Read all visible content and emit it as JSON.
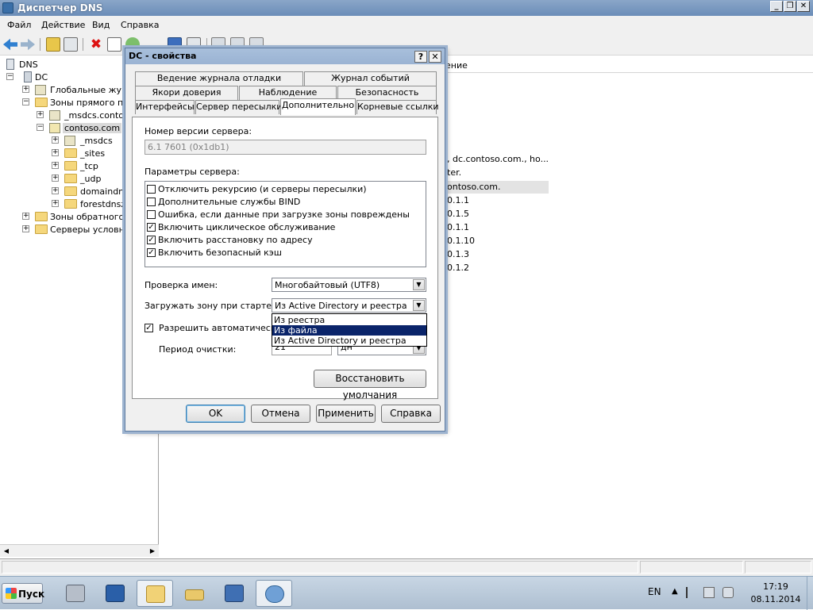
{
  "window": {
    "title": "Диспетчер DNS",
    "controls": {
      "minimize": "_",
      "maximize": "❐",
      "close": "✕"
    }
  },
  "menu": [
    "Файл",
    "Действие",
    "Вид",
    "Справка"
  ],
  "tree": {
    "items": [
      {
        "label": "DNS",
        "icon": "dns-icon"
      },
      {
        "label": "DC",
        "icon": "server-icon"
      },
      {
        "label": "Глобальные журна",
        "icon": "folder-icon"
      },
      {
        "label": "Зоны прямого прос",
        "icon": "folder-icon"
      },
      {
        "label": "_msdcs.contoso",
        "icon": "zone-icon"
      },
      {
        "label": "contoso.com",
        "icon": "zone-icon"
      },
      {
        "label": "_msdcs",
        "icon": "zone-icon"
      },
      {
        "label": "_sites",
        "icon": "folder-icon"
      },
      {
        "label": "_tcp",
        "icon": "folder-icon"
      },
      {
        "label": "_udp",
        "icon": "folder-icon"
      },
      {
        "label": "domaindnsz",
        "icon": "folder-icon"
      },
      {
        "label": "forestdnszo",
        "icon": "folder-icon"
      },
      {
        "label": "Зоны обратного пр",
        "icon": "folder-icon"
      },
      {
        "label": "Серверы условной",
        "icon": "folder-icon"
      }
    ]
  },
  "list": {
    "header_fragment": "ение",
    "cells": [
      ", dc.contoso.com., ho...",
      "ter.",
      "ontoso.com.",
      "0.1.1",
      "0.1.5",
      "0.1.1",
      "0.1.10",
      "0.1.3",
      "0.1.2"
    ]
  },
  "dialog": {
    "title": "DC - свойства",
    "help_btn": "?",
    "close_btn": "✕",
    "tabs_row1": [
      "Ведение журнала отладки",
      "Журнал событий"
    ],
    "tabs_row2": [
      "Якори доверия",
      "Наблюдение",
      "Безопасность"
    ],
    "tabs_row3": [
      "Интерфейсы",
      "Сервер пересылки",
      "Дополнительно",
      "Корневые ссылки"
    ],
    "version_label": "Номер версии сервера:",
    "version_value": "6.1 7601 (0x1db1)",
    "params_label": "Параметры сервера:",
    "options": [
      {
        "label": "Отключить рекурсию (и серверы пересылки)",
        "checked": false
      },
      {
        "label": "Дополнительные службы BIND",
        "checked": false
      },
      {
        "label": "Ошибка, если данные при загрузке зоны повреждены",
        "checked": false
      },
      {
        "label": "Включить циклическое обслуживание",
        "checked": true
      },
      {
        "label": "Включить расстановку по адресу",
        "checked": true
      },
      {
        "label": "Включить безопасный кэш",
        "checked": true
      }
    ],
    "name_check_label": "Проверка имен:",
    "name_check_value": "Многобайтовый (UTF8)",
    "load_zone_label": "Загружать зону при старте:",
    "load_zone_value": "Из Active Directory и реестра",
    "load_zone_options": [
      "Из реестра",
      "Из файла",
      "Из Active Directory и реестра"
    ],
    "load_zone_highlighted": "Из файла",
    "auto_scavenge_label": "Разрешить автоматическое",
    "auto_scavenge_checked": true,
    "scavenge_period_label": "Период очистки:",
    "scavenge_period_value": "21",
    "scavenge_unit_value": "дн",
    "restore_defaults": "Восстановить умолчания",
    "ok": "OK",
    "cancel": "Отмена",
    "apply": "Применить",
    "help": "Справка"
  },
  "taskbar": {
    "start": "Пуск",
    "lang": "EN",
    "time": "17:19",
    "date": "08.11.2014"
  },
  "colors": {
    "selection": "#0a246a",
    "titlebar": "#6b8db8",
    "folder": "#f5d77c"
  }
}
